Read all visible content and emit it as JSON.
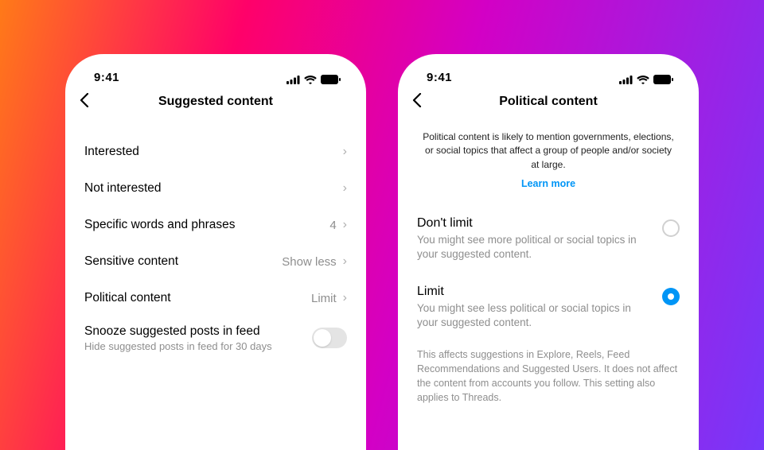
{
  "status": {
    "time": "9:41"
  },
  "left": {
    "title": "Suggested content",
    "rows": [
      {
        "label": "Interested",
        "value": ""
      },
      {
        "label": "Not interested",
        "value": ""
      },
      {
        "label": "Specific words and phrases",
        "value": "4"
      },
      {
        "label": "Sensitive content",
        "value": "Show less"
      },
      {
        "label": "Political content",
        "value": "Limit"
      }
    ],
    "snooze": {
      "title": "Snooze suggested posts in feed",
      "subtitle": "Hide suggested posts in feed for 30 days",
      "on": false
    }
  },
  "right": {
    "title": "Political content",
    "description": "Political content is likely to mention governments, elections, or social topics that affect a group of people and/or society at large.",
    "learn_more": "Learn more",
    "options": [
      {
        "title": "Don't limit",
        "subtitle": "You might see more political or social topics in your suggested content.",
        "selected": false
      },
      {
        "title": "Limit",
        "subtitle": "You might see less political or social topics in your suggested content.",
        "selected": true
      }
    ],
    "footnote": "This affects suggestions in Explore, Reels, Feed Recommendations and Suggested Users. It does not affect the content from accounts you follow. This setting also applies to Threads."
  }
}
